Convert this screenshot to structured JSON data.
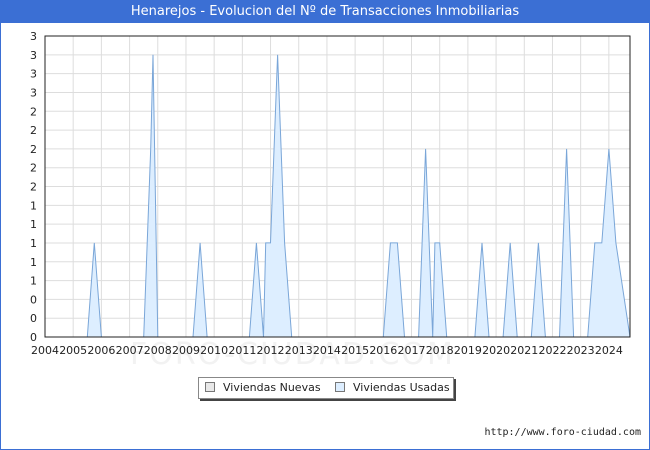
{
  "header": {
    "title": "Henarejos - Evolucion del Nº de Transacciones Inmobiliarias"
  },
  "watermark": "FORO-CIUDAD.COM",
  "footer": {
    "url": "http://www.foro-ciudad.com"
  },
  "chart_data": {
    "type": "area",
    "title": "Henarejos - Evolucion del Nº de Transacciones Inmobiliarias",
    "xlabel": "",
    "ylabel": "",
    "x_tick_labels": [
      "2004",
      "2005",
      "2006",
      "2007",
      "2008",
      "2009",
      "2010",
      "2011",
      "2012",
      "2013",
      "2014",
      "2015",
      "2016",
      "2017",
      "2018",
      "2019",
      "2020",
      "2021",
      "2022",
      "2023",
      "2024"
    ],
    "y_tick_labels": [
      "0",
      "0",
      "0",
      "1",
      "1",
      "1",
      "1",
      "1",
      "2",
      "2",
      "2",
      "2",
      "2",
      "3",
      "3",
      "3",
      "3"
    ],
    "ylim": [
      0,
      3.2
    ],
    "xlim": [
      2004,
      2024.75
    ],
    "grid": true,
    "legend_position": "bottom-center",
    "colors": {
      "nuevas": "#e8e8e8",
      "usadas_fill": "#ddeeff",
      "usadas_line": "#7aa6d8",
      "title_bar": "#3b6fd4"
    },
    "series": [
      {
        "name": "Viviendas Nuevas",
        "points": []
      },
      {
        "name": "Viviendas Usadas",
        "points": [
          [
            2004,
            0
          ],
          [
            2005.5,
            0
          ],
          [
            2005.75,
            1
          ],
          [
            2006,
            0
          ],
          [
            2007.5,
            0
          ],
          [
            2007.75,
            2
          ],
          [
            2007.83,
            3
          ],
          [
            2008,
            0
          ],
          [
            2009.25,
            0
          ],
          [
            2009.5,
            1
          ],
          [
            2009.75,
            0
          ],
          [
            2011.25,
            0
          ],
          [
            2011.5,
            1
          ],
          [
            2011.75,
            0
          ],
          [
            2011.83,
            1
          ],
          [
            2012,
            1
          ],
          [
            2012.25,
            3
          ],
          [
            2012.5,
            1
          ],
          [
            2012.75,
            0
          ],
          [
            2016,
            0
          ],
          [
            2016.25,
            1
          ],
          [
            2016.5,
            1
          ],
          [
            2016.75,
            0
          ],
          [
            2017.25,
            0
          ],
          [
            2017.5,
            2
          ],
          [
            2017.75,
            0
          ],
          [
            2017.83,
            1
          ],
          [
            2018,
            1
          ],
          [
            2018.25,
            0
          ],
          [
            2019.25,
            0
          ],
          [
            2019.5,
            1
          ],
          [
            2019.75,
            0
          ],
          [
            2020.25,
            0
          ],
          [
            2020.5,
            1
          ],
          [
            2020.75,
            0
          ],
          [
            2021.25,
            0
          ],
          [
            2021.5,
            1
          ],
          [
            2021.75,
            0
          ],
          [
            2022.25,
            0
          ],
          [
            2022.5,
            2
          ],
          [
            2022.75,
            0
          ],
          [
            2023.25,
            0
          ],
          [
            2023.5,
            1
          ],
          [
            2023.75,
            1
          ],
          [
            2024,
            2
          ],
          [
            2024.25,
            1
          ],
          [
            2024.75,
            0
          ]
        ]
      }
    ]
  }
}
